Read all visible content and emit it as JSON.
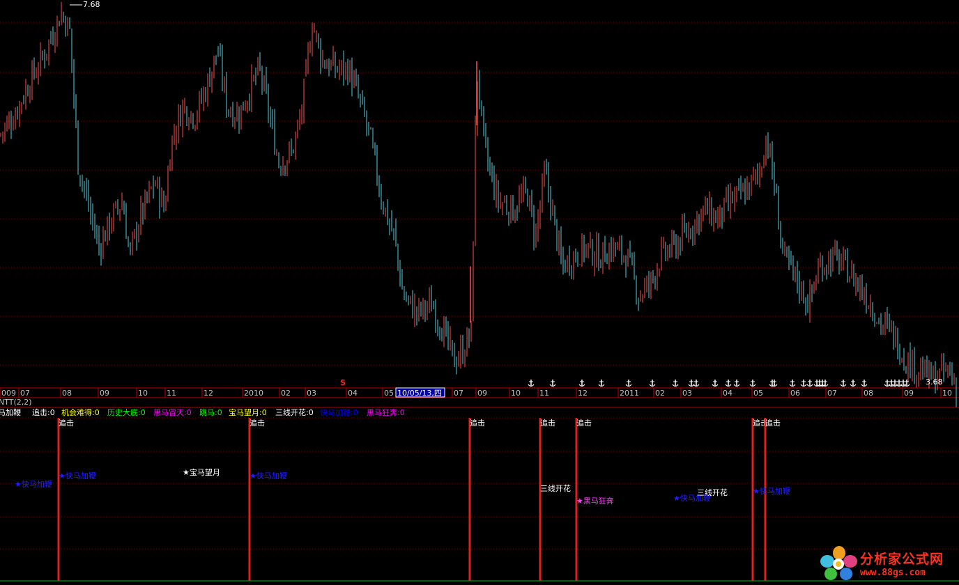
{
  "price_panel": {
    "high_label": "7.68",
    "low_label": "3.68",
    "cursor_date": "10/05/13,四",
    "s_marker": "S",
    "time_axis": [
      "009",
      "07",
      "08",
      "09",
      "10",
      "11",
      "12",
      "2010",
      "02",
      "03",
      "04",
      "05",
      "10/05/13,四",
      "07",
      "09",
      "10",
      "11",
      "12",
      "2011",
      "02",
      "03",
      "04",
      "05",
      "06",
      "07",
      "08",
      "09",
      "10"
    ]
  },
  "indicator_panel": {
    "title": "NTT(2,2)",
    "legend": [
      {
        "text": "快马加鞭",
        "color": "#ffffff"
      },
      {
        "text": "追击:0",
        "color": "#ffffff"
      },
      {
        "text": "机会难得:0",
        "color": "#ffff00"
      },
      {
        "text": "历史大底:0",
        "color": "#00ff00"
      },
      {
        "text": "黑马冒天:0",
        "color": "#ff00ff"
      },
      {
        "text": "跳马:0",
        "color": "#00ff00"
      },
      {
        "text": "宝马望月:0",
        "color": "#ffff00"
      },
      {
        "text": "三线开花:0",
        "color": "#ffffff"
      },
      {
        "text": "快马加鞭:0",
        "color": "#0000ff"
      },
      {
        "text": "黑马狂奔:0",
        "color": "#ff00ff"
      }
    ],
    "zhuiji_label": "追击",
    "signals": [
      {
        "text": "★快马加鞭",
        "color": "#2020ff"
      },
      {
        "text": "★快马加鞭",
        "color": "#2020ff"
      },
      {
        "text": "★宝马望月",
        "color": "#ffffff"
      },
      {
        "text": "★快马加鞭",
        "color": "#2020ff"
      },
      {
        "text": "三线开花",
        "color": "#ffffff"
      },
      {
        "text": "★黑马狂奔",
        "color": "#ff40ff"
      },
      {
        "text": "★快马加鞭",
        "color": "#2020ff"
      },
      {
        "text": "三线开花",
        "color": "#ffffff"
      },
      {
        "text": "★快马加鞭",
        "color": "#2020ff"
      }
    ]
  },
  "watermark": {
    "title": "分析家公式网",
    "url": "www.88gs.com"
  },
  "colors": {
    "up": "#ff5050",
    "down": "#50d0e0",
    "grid": "#800000",
    "axis": "#c00000",
    "signal_bar": "#e02020"
  },
  "chart_data": {
    "type": "candlestick",
    "title": "",
    "ylim": [
      3.68,
      7.68
    ],
    "close_anchors": [
      [
        "2009-06",
        6.5
      ],
      [
        "2009-07",
        6.9
      ],
      [
        "2009-08",
        7.3
      ],
      [
        "2009-09",
        5.4
      ],
      [
        "2009-10",
        5.6
      ],
      [
        "2009-11",
        6.5
      ],
      [
        "2009-12",
        6.8
      ],
      [
        "2010-01",
        6.6
      ],
      [
        "2010-02",
        6.4
      ],
      [
        "2010-03",
        7.3
      ],
      [
        "2010-04",
        6.9
      ],
      [
        "2010-05",
        5.3
      ],
      [
        "2010-06",
        4.5
      ],
      [
        "2010-07",
        6.8
      ],
      [
        "2010-09",
        5.7
      ],
      [
        "2010-10",
        5.6
      ],
      [
        "2010-11",
        5.2
      ],
      [
        "2010-12",
        5.3
      ],
      [
        "2011-01",
        5.0
      ],
      [
        "2011-02",
        5.6
      ],
      [
        "2011-03",
        5.9
      ],
      [
        "2011-04",
        6.0
      ],
      [
        "2011-05",
        6.4
      ],
      [
        "2011-06",
        5.0
      ],
      [
        "2011-07",
        5.1
      ],
      [
        "2011-08",
        4.8
      ],
      [
        "2011-09",
        4.5
      ],
      [
        "2011-10",
        3.9
      ]
    ],
    "signal_events": [
      "追击",
      "追击",
      "追击",
      "追击",
      "追击",
      "追击",
      "追击"
    ]
  }
}
